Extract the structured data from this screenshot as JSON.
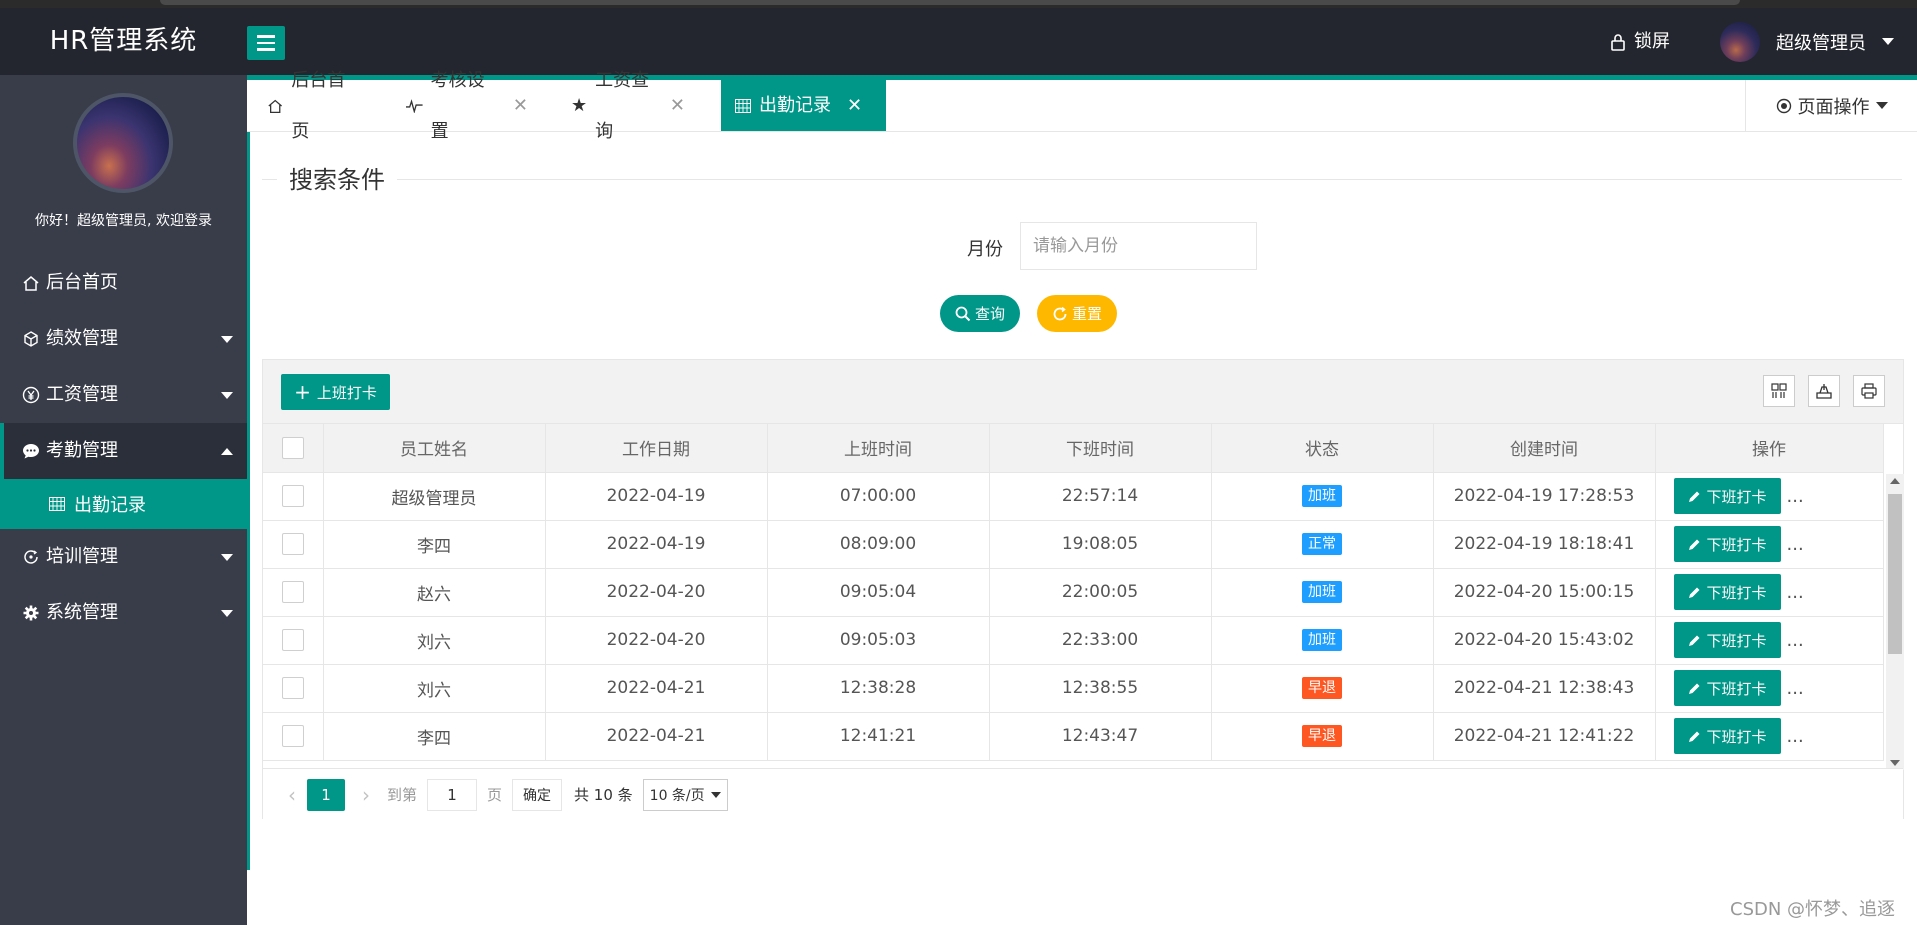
{
  "header": {
    "brand": "HR管理系统",
    "lock_label": "锁屏",
    "user_label": "超级管理员"
  },
  "sidebar": {
    "welcome": "你好！超级管理员, 欢迎登录",
    "items": [
      {
        "label": "后台首页",
        "icon": "home-icon"
      },
      {
        "label": "绩效管理",
        "icon": "cube-icon"
      },
      {
        "label": "工资管理",
        "icon": "yen-icon"
      },
      {
        "label": "考勤管理",
        "icon": "chat-icon"
      },
      {
        "label": "培训管理",
        "icon": "training-icon"
      },
      {
        "label": "系统管理",
        "icon": "gear-icon"
      }
    ],
    "sub_item": {
      "label": "出勤记录",
      "icon": "grid-icon"
    }
  },
  "tabs": [
    {
      "label": "后台首页",
      "icon": "home-icon"
    },
    {
      "label": "考核设置",
      "icon": "pulse-icon"
    },
    {
      "label": "工资查询",
      "icon": "star-icon"
    },
    {
      "label": "出勤记录",
      "icon": "grid-icon"
    }
  ],
  "page_ops": "页面操作",
  "search": {
    "legend": "搜索条件",
    "month_label": "月份",
    "month_placeholder": "请输入月份",
    "query_label": "查询",
    "reset_label": "重置"
  },
  "toolbar": {
    "clockin_label": "上班打卡"
  },
  "table": {
    "columns": [
      "员工姓名",
      "工作日期",
      "上班时间",
      "下班时间",
      "状态",
      "创建时间",
      "操作"
    ],
    "rows": [
      {
        "name": "超级管理员",
        "date": "2022-04-19",
        "start": "07:00:00",
        "end": "22:57:14",
        "status": "加班",
        "status_color": "#1e9fff",
        "created": "2022-04-19 17:28:53"
      },
      {
        "name": "李四",
        "date": "2022-04-19",
        "start": "08:09:00",
        "end": "19:08:05",
        "status": "正常",
        "status_color": "#1e9fff",
        "created": "2022-04-19 18:18:41"
      },
      {
        "name": "赵六",
        "date": "2022-04-20",
        "start": "09:05:04",
        "end": "22:00:05",
        "status": "加班",
        "status_color": "#1e9fff",
        "created": "2022-04-20 15:00:15"
      },
      {
        "name": "刘六",
        "date": "2022-04-20",
        "start": "09:05:03",
        "end": "22:33:00",
        "status": "加班",
        "status_color": "#1e9fff",
        "created": "2022-04-20 15:43:02"
      },
      {
        "name": "刘六",
        "date": "2022-04-21",
        "start": "12:38:28",
        "end": "12:38:55",
        "status": "早退",
        "status_color": "#ff5722",
        "created": "2022-04-21 12:38:43"
      },
      {
        "name": "李四",
        "date": "2022-04-21",
        "start": "12:41:21",
        "end": "12:43:47",
        "status": "早退",
        "status_color": "#ff5722",
        "created": "2022-04-21 12:41:22"
      }
    ],
    "op_label": "下班打卡",
    "op_more": "..."
  },
  "pager": {
    "current": "1",
    "goto_label": "到第",
    "goto_value": "1",
    "page_unit": "页",
    "confirm_label": "确定",
    "total_label": "共 10 条",
    "size_label": "10 条/页"
  },
  "watermark": "CSDN @怀梦、追逐",
  "colors": {
    "accent": "#009688",
    "warn": "#ffb800",
    "sidebar": "#393d49",
    "header": "#23262e"
  }
}
